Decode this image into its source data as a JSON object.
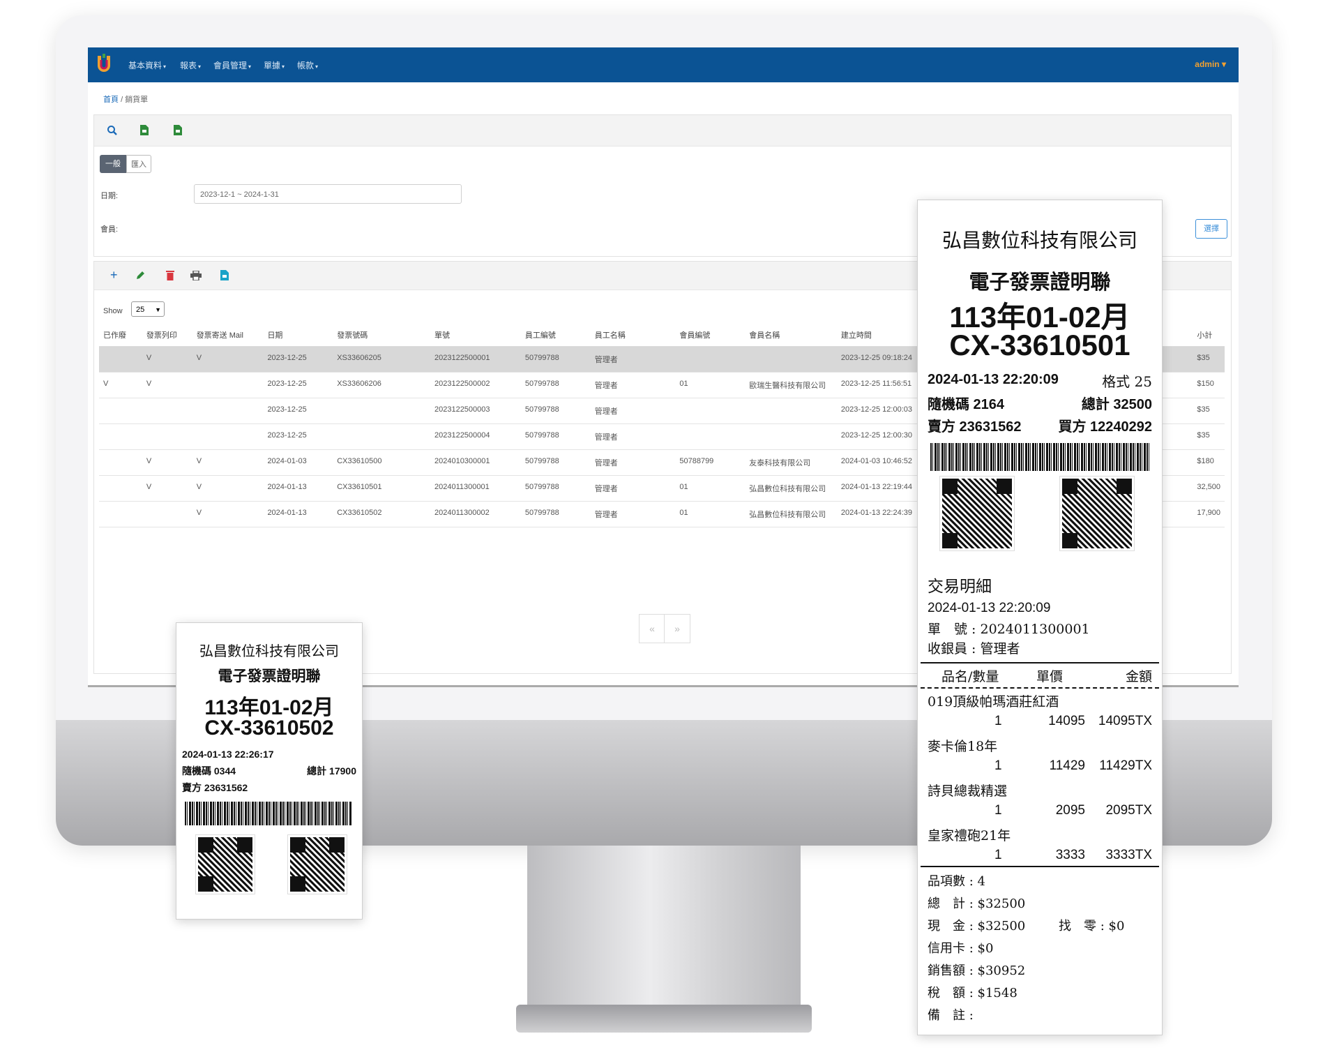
{
  "navbar": {
    "menus": [
      "基本資料",
      "報表",
      "會員管理",
      "單據",
      "帳款"
    ],
    "user": "admin"
  },
  "breadcrumb": {
    "home": "首頁",
    "separator": "/",
    "current": "銷貨單"
  },
  "filter": {
    "tabs": [
      "一般",
      "匯入"
    ],
    "date_label": "日期:",
    "date_value": "2023-12-1 ~ 2024-1-31",
    "member_label": "會員:",
    "select_button": "選擇"
  },
  "list": {
    "show_label": "Show",
    "page_size": "25",
    "columns": [
      "已作廢",
      "發票列印",
      "發票寄送 Mail",
      "日期",
      "發票號碼",
      "單號",
      "員工編號",
      "員工名稱",
      "會員編號",
      "會員名稱",
      "建立時間",
      "小計"
    ],
    "rows": [
      {
        "void": "",
        "printed": "V",
        "mail": "V",
        "date": "2023-12-25",
        "invoice": "XS33606205",
        "order": "2023122500001",
        "emp_no": "50799788",
        "emp_name": "管理者",
        "member_no": "",
        "member_name": "",
        "created": "2023-12-25 09:18:24",
        "subtotal": "$35"
      },
      {
        "void": "V",
        "printed": "V",
        "mail": "",
        "date": "2023-12-25",
        "invoice": "XS33606206",
        "order": "2023122500002",
        "emp_no": "50799788",
        "emp_name": "管理者",
        "member_no": "01",
        "member_name": "歐瑞生醫科技有限公司",
        "created": "2023-12-25 11:56:51",
        "subtotal": "$150"
      },
      {
        "void": "",
        "printed": "",
        "mail": "",
        "date": "2023-12-25",
        "invoice": "",
        "order": "2023122500003",
        "emp_no": "50799788",
        "emp_name": "管理者",
        "member_no": "",
        "member_name": "",
        "created": "2023-12-25 12:00:03",
        "subtotal": "$35"
      },
      {
        "void": "",
        "printed": "",
        "mail": "",
        "date": "2023-12-25",
        "invoice": "",
        "order": "2023122500004",
        "emp_no": "50799788",
        "emp_name": "管理者",
        "member_no": "",
        "member_name": "",
        "created": "2023-12-25 12:00:30",
        "subtotal": "$35"
      },
      {
        "void": "",
        "printed": "V",
        "mail": "V",
        "date": "2024-01-03",
        "invoice": "CX33610500",
        "order": "2024010300001",
        "emp_no": "50799788",
        "emp_name": "管理者",
        "member_no": "50788799",
        "member_name": "友泰科技有限公司",
        "created": "2024-01-03 10:46:52",
        "subtotal": "$180"
      },
      {
        "void": "",
        "printed": "V",
        "mail": "V",
        "date": "2024-01-13",
        "invoice": "CX33610501",
        "order": "2024011300001",
        "emp_no": "50799788",
        "emp_name": "管理者",
        "member_no": "01",
        "member_name": "弘昌數位科技有限公司",
        "created": "2024-01-13 22:19:44",
        "subtotal": "32,500"
      },
      {
        "void": "",
        "printed": "",
        "mail": "V",
        "date": "2024-01-13",
        "invoice": "CX33610502",
        "order": "2024011300002",
        "emp_no": "50799788",
        "emp_name": "管理者",
        "member_no": "01",
        "member_name": "弘昌數位科技有限公司",
        "created": "2024-01-13 22:24:39",
        "subtotal": "17,900"
      }
    ]
  },
  "pager": {
    "prev": "«",
    "next": "»"
  },
  "receipt_large": {
    "company": "弘昌數位科技有限公司",
    "doc_title": "電子發票證明聯",
    "period": "113年01-02月",
    "invoice_no": "CX-33610501",
    "datetime": "2024-01-13 22:20:09",
    "format": "格式 25",
    "random_code": "隨機碼 2164",
    "total": "總計 32500",
    "seller": "賣方 23631562",
    "buyer": "買方 12240292",
    "detail_title": "交易明細",
    "detail_datetime": "2024-01-13 22:20:09",
    "order_line": "單　號 : 2024011300001",
    "cashier_line": "收銀員 : 管理者",
    "head_name": "品名/數量",
    "head_price": "單價",
    "head_amount": "金額",
    "items": [
      {
        "name": "019頂級帕瑪酒莊紅酒",
        "qty": "1",
        "price": "14095",
        "amount": "14095TX"
      },
      {
        "name": "麥卡倫18年",
        "qty": "1",
        "price": "11429",
        "amount": "11429TX"
      },
      {
        "name": "詩貝總裁精選",
        "qty": "1",
        "price": "2095",
        "amount": "2095TX"
      },
      {
        "name": "皇家禮砲21年",
        "qty": "1",
        "price": "3333",
        "amount": "3333TX"
      }
    ],
    "item_count": "品項數 : 4",
    "sum_total": "總　計 : $32500",
    "cash": "現　金 : $32500",
    "change": "找　零 : $0",
    "credit": "信用卡 : $0",
    "sales": "銷售額 : $30952",
    "tax": "稅　額 : $1548",
    "note": "備　註 :"
  },
  "receipt_small": {
    "company": "弘昌數位科技有限公司",
    "doc_title": "電子發票證明聯",
    "period": "113年01-02月",
    "invoice_no": "CX-33610502",
    "datetime": "2024-01-13 22:26:17",
    "random_code": "隨機碼 0344",
    "total": "總計 17900",
    "seller": "賣方 23631562"
  },
  "colors": {
    "navbar": "#0b5394",
    "admin": "#f0a030",
    "link": "#1a6ab8",
    "add": "#1a6ab8",
    "edit": "#2e8b3a",
    "delete": "#d9363e"
  }
}
